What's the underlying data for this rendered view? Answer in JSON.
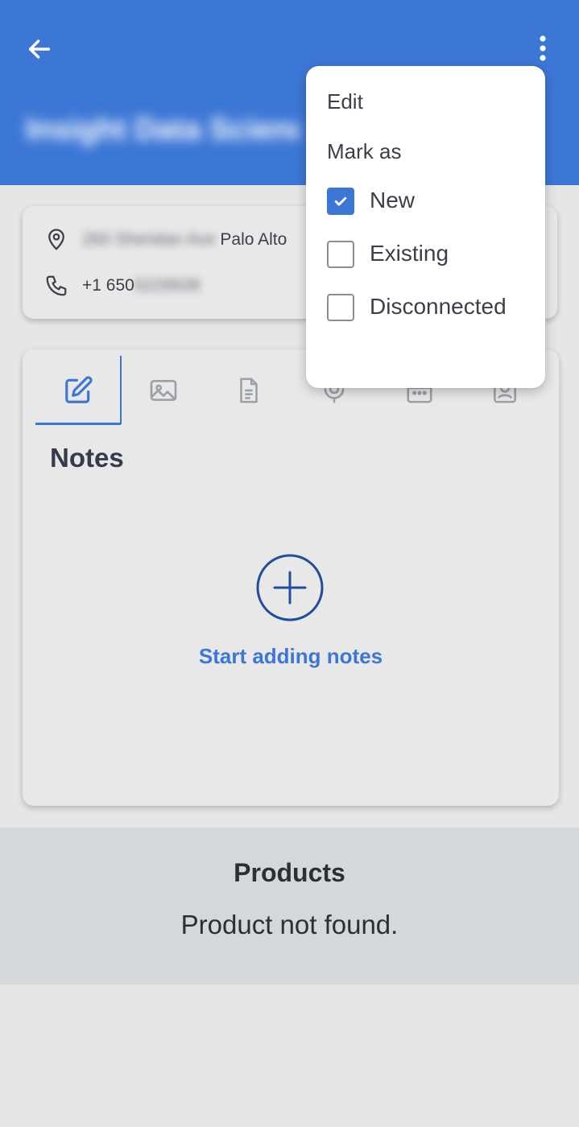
{
  "header": {
    "title": "Insight Data Science",
    "back_icon": "arrow-left-icon",
    "menu_icon": "more-vert-icon",
    "color": "#3d77d6"
  },
  "contact": {
    "address_prefix": "260 Sheridan Ave",
    "address_city": "Palo Alto",
    "phone_prefix": "+1 650",
    "phone_rest": "6229938"
  },
  "tabs": [
    {
      "icon": "edit-icon",
      "active": true
    },
    {
      "icon": "image-icon",
      "active": false
    },
    {
      "icon": "document-icon",
      "active": false
    },
    {
      "icon": "microphone-icon",
      "active": false
    },
    {
      "icon": "calendar-icon",
      "active": false
    },
    {
      "icon": "contact-icon",
      "active": false
    }
  ],
  "notes": {
    "title": "Notes",
    "add_label": "Start adding notes"
  },
  "products": {
    "title": "Products",
    "empty_text": "Product not found."
  },
  "menu": {
    "edit_label": "Edit",
    "mark_as_label": "Mark as",
    "options": [
      {
        "label": "New",
        "checked": true
      },
      {
        "label": "Existing",
        "checked": false
      },
      {
        "label": "Disconnected",
        "checked": false
      }
    ]
  }
}
